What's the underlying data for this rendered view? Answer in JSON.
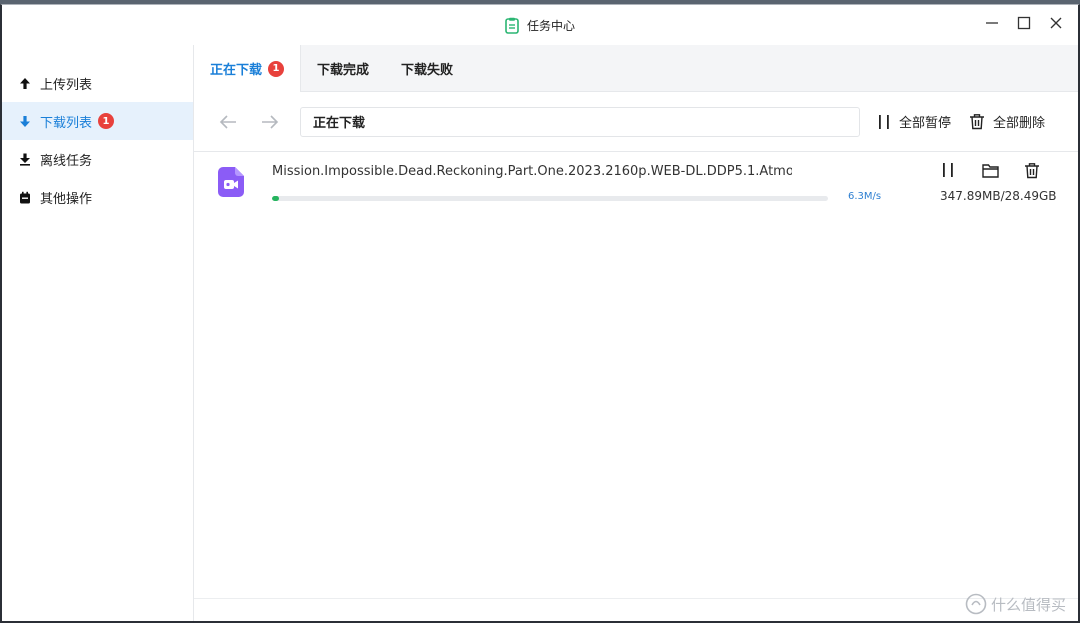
{
  "window": {
    "title": "任务中心",
    "app_icon": "clipboard-icon",
    "accent": "#1a7fd8"
  },
  "sidebar": {
    "items": [
      {
        "label": "上传列表",
        "icon": "upload-arrow-icon"
      },
      {
        "label": "下载列表",
        "icon": "download-arrow-icon",
        "badge": "1",
        "active": true
      },
      {
        "label": "离线任务",
        "icon": "offline-download-icon"
      },
      {
        "label": "其他操作",
        "icon": "calendar-icon"
      }
    ]
  },
  "tabs": [
    {
      "label": "正在下载",
      "badge": "1",
      "active": true
    },
    {
      "label": "下载完成"
    },
    {
      "label": "下载失败"
    }
  ],
  "toolbar": {
    "path": "正在下载",
    "pause_all": "全部暂停",
    "delete_all": "全部删除"
  },
  "tasks": [
    {
      "name": "Mission.Impossible.Dead.Reckoning.Part.One.2023.2160p.WEB-DL.DDP5.1.Atmo...",
      "speed": "6.3M/s",
      "size": "347.89MB/28.49GB",
      "progress_percent": 1.2,
      "progress_color": "#25b45e",
      "icon": "video-file-icon"
    }
  ],
  "watermark": {
    "text": "什么值得买",
    "icon": "smzdm-logo-icon"
  }
}
